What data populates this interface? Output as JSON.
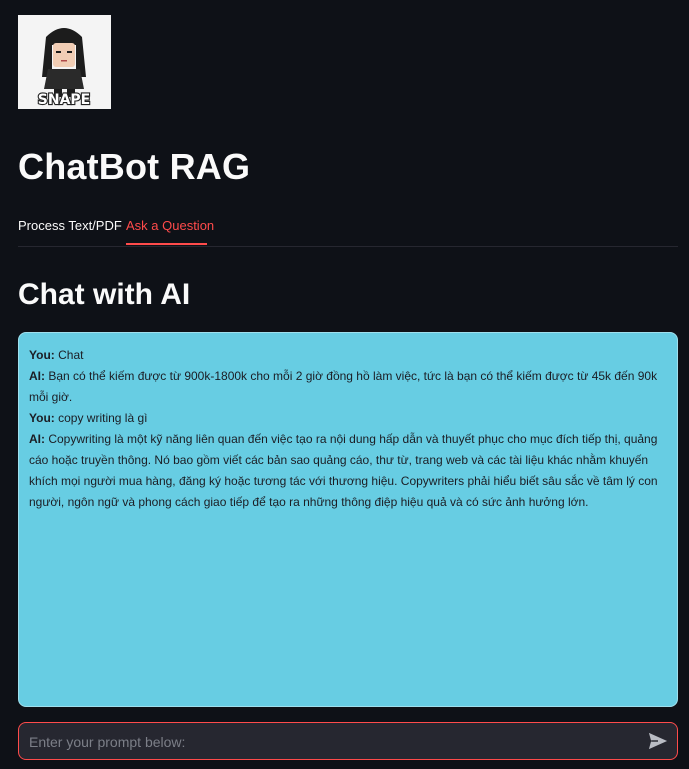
{
  "logo": {
    "alt": "Snape avatar logo",
    "text": "SNAPE",
    "icon": "snape-avatar-icon"
  },
  "app": {
    "title": "ChatBot RAG"
  },
  "tabs": [
    {
      "label": "Process Text/PDF",
      "active": false
    },
    {
      "label": "Ask a Question",
      "active": true
    }
  ],
  "chat": {
    "heading": "Chat with AI",
    "messages": [
      {
        "speaker": "You:",
        "text": " Chat"
      },
      {
        "speaker": "AI:",
        "text": " Bạn có thể kiếm được từ 900k-1800k cho mỗi 2 giờ đồng hồ làm việc, tức là bạn có thể kiếm được từ 45k đến 90k mỗi giờ."
      },
      {
        "speaker": "You:",
        "text": " copy writing là gì"
      },
      {
        "speaker": "AI:",
        "text": " Copywriting là một kỹ năng liên quan đến việc tạo ra nội dung hấp dẫn và thuyết phục cho mục đích tiếp thị, quảng cáo hoặc truyền thông. Nó bao gồm viết các bản sao quảng cáo, thư từ, trang web và các tài liệu khác nhằm khuyến khích mọi người mua hàng, đăng ký hoặc tương tác với thương hiệu. Copywriters phải hiểu biết sâu sắc về tâm lý con người, ngôn ngữ và phong cách giao tiếp để tạo ra những thông điệp hiệu quả và có sức ảnh hưởng lớn."
      }
    ]
  },
  "prompt": {
    "placeholder": "Enter your prompt below:",
    "value": "",
    "send_icon": "send-icon"
  },
  "colors": {
    "background": "#0e1117",
    "accent": "#ff4b4b",
    "chat_box": "#67cde3",
    "input_bg": "#262730"
  }
}
